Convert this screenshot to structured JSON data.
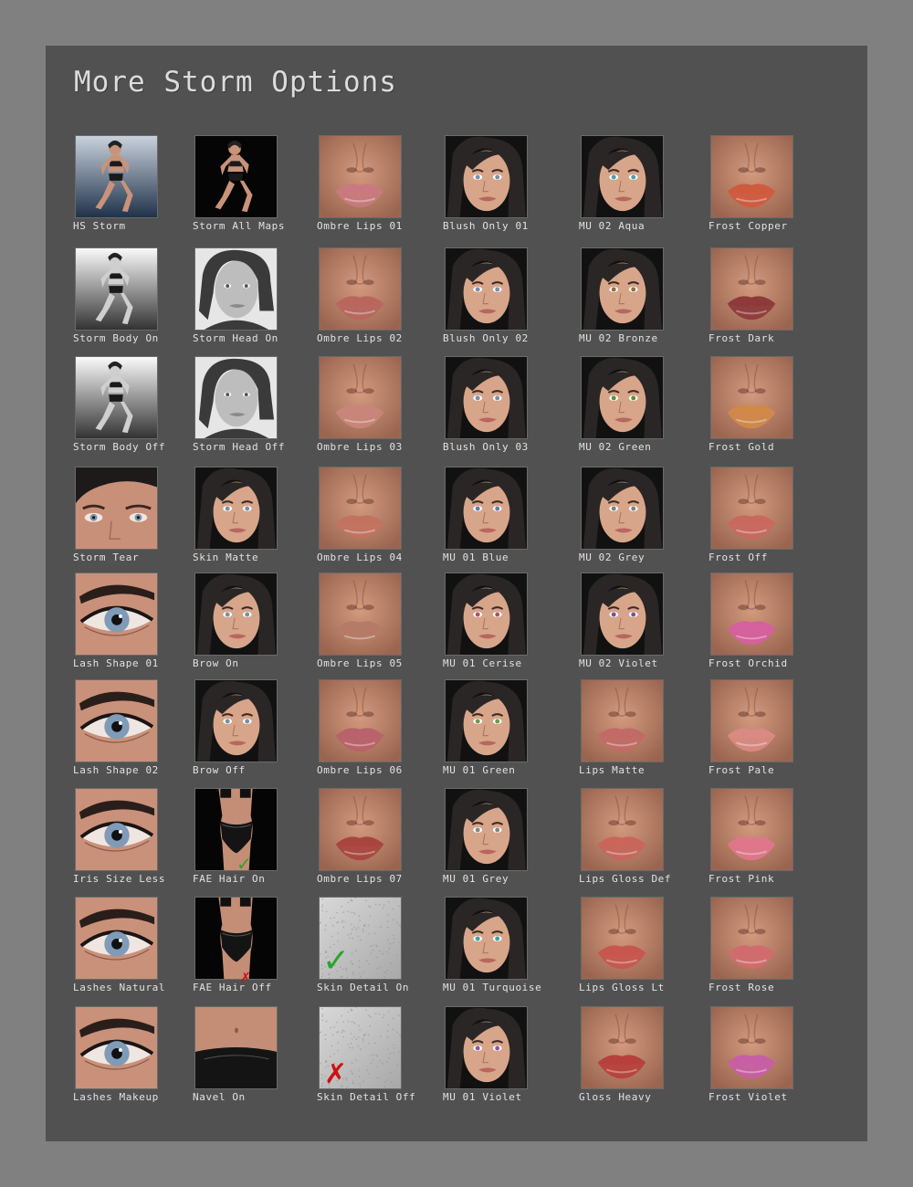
{
  "header": {
    "title": "More Storm Options"
  },
  "colors": {
    "frame": "#808080",
    "panel": "#515151",
    "text": "#e2e2e2",
    "check": "#2aa52a",
    "cross": "#cc1111"
  },
  "grid": {
    "columns": [
      {
        "items": [
          {
            "label": "HS Storm",
            "kind": "figure-gradient",
            "icon": "figure-thumbnail"
          },
          {
            "label": "Storm Body On",
            "kind": "figure-white",
            "icon": "figure-thumbnail"
          },
          {
            "label": "Storm Body Off",
            "kind": "figure-white",
            "icon": "figure-thumbnail"
          },
          {
            "label": "Storm Tear",
            "kind": "eyes-wide",
            "icon": "eyes-thumbnail"
          },
          {
            "label": "Lash Shape 01",
            "kind": "eye",
            "icon": "eye-thumbnail"
          },
          {
            "label": "Lash Shape 02",
            "kind": "eye",
            "icon": "eye-thumbnail"
          },
          {
            "label": "Iris Size Less",
            "kind": "eye",
            "icon": "eye-thumbnail"
          },
          {
            "label": "Lashes Natural",
            "kind": "eye",
            "icon": "eye-thumbnail"
          },
          {
            "label": "Lashes Makeup",
            "kind": "eye",
            "icon": "eye-thumbnail"
          }
        ]
      },
      {
        "items": [
          {
            "label": "Storm All Maps",
            "kind": "figure-dark",
            "icon": "figure-thumbnail"
          },
          {
            "label": "Storm Head On",
            "kind": "head-grey",
            "icon": "head-thumbnail"
          },
          {
            "label": "Storm Head Off",
            "kind": "head-grey",
            "icon": "head-thumbnail"
          },
          {
            "label": "Skin Matte",
            "kind": "face-dark",
            "icon": "face-thumbnail"
          },
          {
            "label": "Brow On",
            "kind": "face",
            "icon": "face-thumbnail"
          },
          {
            "label": "Brow Off",
            "kind": "face",
            "icon": "face-thumbnail"
          },
          {
            "label": "FAE Hair On",
            "kind": "torso",
            "icon": "torso-thumbnail",
            "mark": "check"
          },
          {
            "label": "FAE Hair Off",
            "kind": "torso",
            "icon": "torso-thumbnail",
            "mark": "cross"
          },
          {
            "label": "Navel On",
            "kind": "waist",
            "icon": "waist-thumbnail"
          }
        ]
      },
      {
        "items": [
          {
            "label": "Ombre Lips 01",
            "kind": "lips",
            "lip": "#c97a7e",
            "icon": "lips-thumbnail"
          },
          {
            "label": "Ombre Lips 02",
            "kind": "lips",
            "lip": "#b8665e",
            "icon": "lips-thumbnail"
          },
          {
            "label": "Ombre Lips 03",
            "kind": "lips",
            "lip": "#c9857a",
            "icon": "lips-thumbnail"
          },
          {
            "label": "Ombre Lips 04",
            "kind": "lips",
            "lip": "#c2735f",
            "icon": "lips-thumbnail"
          },
          {
            "label": "Ombre Lips 05",
            "kind": "lips",
            "lip": "#b47b67",
            "icon": "lips-thumbnail"
          },
          {
            "label": "Ombre Lips 06",
            "kind": "lips",
            "lip": "#b8626a",
            "icon": "lips-thumbnail"
          },
          {
            "label": "Ombre Lips 07",
            "kind": "lips",
            "lip": "#a8453f",
            "icon": "lips-thumbnail"
          },
          {
            "label": "Skin Detail On",
            "kind": "texture",
            "icon": "texture-thumbnail",
            "mark": "check"
          },
          {
            "label": "Skin Detail Off",
            "kind": "texture",
            "icon": "texture-thumbnail",
            "mark": "cross"
          }
        ]
      },
      {
        "items": [
          {
            "label": "Blush Only 01",
            "kind": "face",
            "icon": "face-thumbnail"
          },
          {
            "label": "Blush Only 02",
            "kind": "face",
            "icon": "face-thumbnail"
          },
          {
            "label": "Blush Only 03",
            "kind": "face",
            "icon": "face-thumbnail"
          },
          {
            "label": "MU 01 Blue",
            "kind": "face",
            "icon": "face-thumbnail",
            "eye": "#5b7fb5"
          },
          {
            "label": "MU 01 Cerise",
            "kind": "face",
            "icon": "face-thumbnail",
            "eye": "#a7536e"
          },
          {
            "label": "MU 01 Green",
            "kind": "face",
            "icon": "face-thumbnail",
            "eye": "#6c9a4b"
          },
          {
            "label": "MU 01 Grey",
            "kind": "face",
            "icon": "face-thumbnail",
            "eye": "#808888"
          },
          {
            "label": "MU 01 Turquoise",
            "kind": "face",
            "icon": "face-thumbnail",
            "eye": "#3ea3a0"
          },
          {
            "label": "MU 01 Violet",
            "kind": "face",
            "icon": "face-thumbnail",
            "eye": "#8a5aa0"
          }
        ]
      },
      {
        "items": [
          {
            "label": "MU 02 Aqua",
            "kind": "face",
            "icon": "face-thumbnail",
            "eye": "#4aa0b0"
          },
          {
            "label": "MU 02 Bronze",
            "kind": "face",
            "icon": "face-thumbnail",
            "eye": "#9a6b3a"
          },
          {
            "label": "MU 02 Green",
            "kind": "face",
            "icon": "face-thumbnail",
            "eye": "#5c8f3c"
          },
          {
            "label": "MU 02 Grey",
            "kind": "face",
            "icon": "face-thumbnail",
            "eye": "#7d8282"
          },
          {
            "label": "MU 02 Violet",
            "kind": "face",
            "icon": "face-thumbnail",
            "eye": "#7a5293"
          },
          {
            "label": "Lips Matte",
            "kind": "lips",
            "lip": "#c26a66",
            "icon": "lips-thumbnail"
          },
          {
            "label": "Lips Gloss Def",
            "kind": "lips",
            "lip": "#c9655b",
            "icon": "lips-thumbnail"
          },
          {
            "label": "Lips Gloss Lt",
            "kind": "lips",
            "lip": "#c7564e",
            "icon": "lips-thumbnail"
          },
          {
            "label": "Gloss Heavy",
            "kind": "lips",
            "lip": "#b7403c",
            "icon": "lips-thumbnail"
          }
        ]
      },
      {
        "items": [
          {
            "label": "Frost Copper",
            "kind": "lips",
            "lip": "#d05a3e",
            "icon": "lips-thumbnail"
          },
          {
            "label": "Frost Dark",
            "kind": "lips",
            "lip": "#8c3a3a",
            "icon": "lips-thumbnail"
          },
          {
            "label": "Frost Gold",
            "kind": "lips",
            "lip": "#d1894a",
            "icon": "lips-thumbnail"
          },
          {
            "label": "Frost Off",
            "kind": "lips",
            "lip": "#c9685e",
            "icon": "lips-thumbnail"
          },
          {
            "label": "Frost Orchid",
            "kind": "lips",
            "lip": "#d65fa0",
            "icon": "lips-thumbnail"
          },
          {
            "label": "Frost Pale",
            "kind": "lips",
            "lip": "#d98a83",
            "icon": "lips-thumbnail"
          },
          {
            "label": "Frost Pink",
            "kind": "lips",
            "lip": "#e0768c",
            "icon": "lips-thumbnail"
          },
          {
            "label": "Frost Rose",
            "kind": "lips",
            "lip": "#d16b6d",
            "icon": "lips-thumbnail"
          },
          {
            "label": "Frost Violet",
            "kind": "lips",
            "lip": "#c85ea6",
            "icon": "lips-thumbnail"
          }
        ]
      }
    ]
  }
}
